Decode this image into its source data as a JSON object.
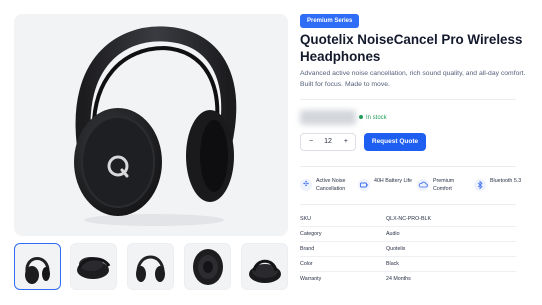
{
  "product": {
    "badge": "Premium Series",
    "title": "Quotelix NoiseCancel Pro Wireless Headphones",
    "description": "Advanced active noise cancellation, rich sound quality, and all-day comfort. Built for focus. Made to move.",
    "stock_status": "In stock"
  },
  "purchase": {
    "quantity": "12",
    "minus_label": "−",
    "plus_label": "+",
    "button_label": "Request Quote"
  },
  "features": [
    {
      "label": "Active Noise Cancellation",
      "icon": "anc-icon"
    },
    {
      "label": "40H Battery Life",
      "icon": "battery-icon"
    },
    {
      "label": "Premium Comfort",
      "icon": "cloud-icon"
    },
    {
      "label": "Bluetooth 5.3",
      "icon": "bluetooth-icon"
    }
  ],
  "specs": [
    {
      "key": "SKU",
      "value": "QLX-NC-PRO-BLK"
    },
    {
      "key": "Category",
      "value": "Audio"
    },
    {
      "key": "Brand",
      "value": "Quotelix"
    },
    {
      "key": "Color",
      "value": "Black"
    },
    {
      "key": "Warranty",
      "value": "24 Months"
    }
  ],
  "gallery": {
    "thumbnails": [
      "front view",
      "folded",
      "back view",
      "ear cup detail",
      "in case"
    ],
    "selected_index": 0
  },
  "colors": {
    "accent": "#1e5ef0",
    "stock": "#1f9d58"
  }
}
